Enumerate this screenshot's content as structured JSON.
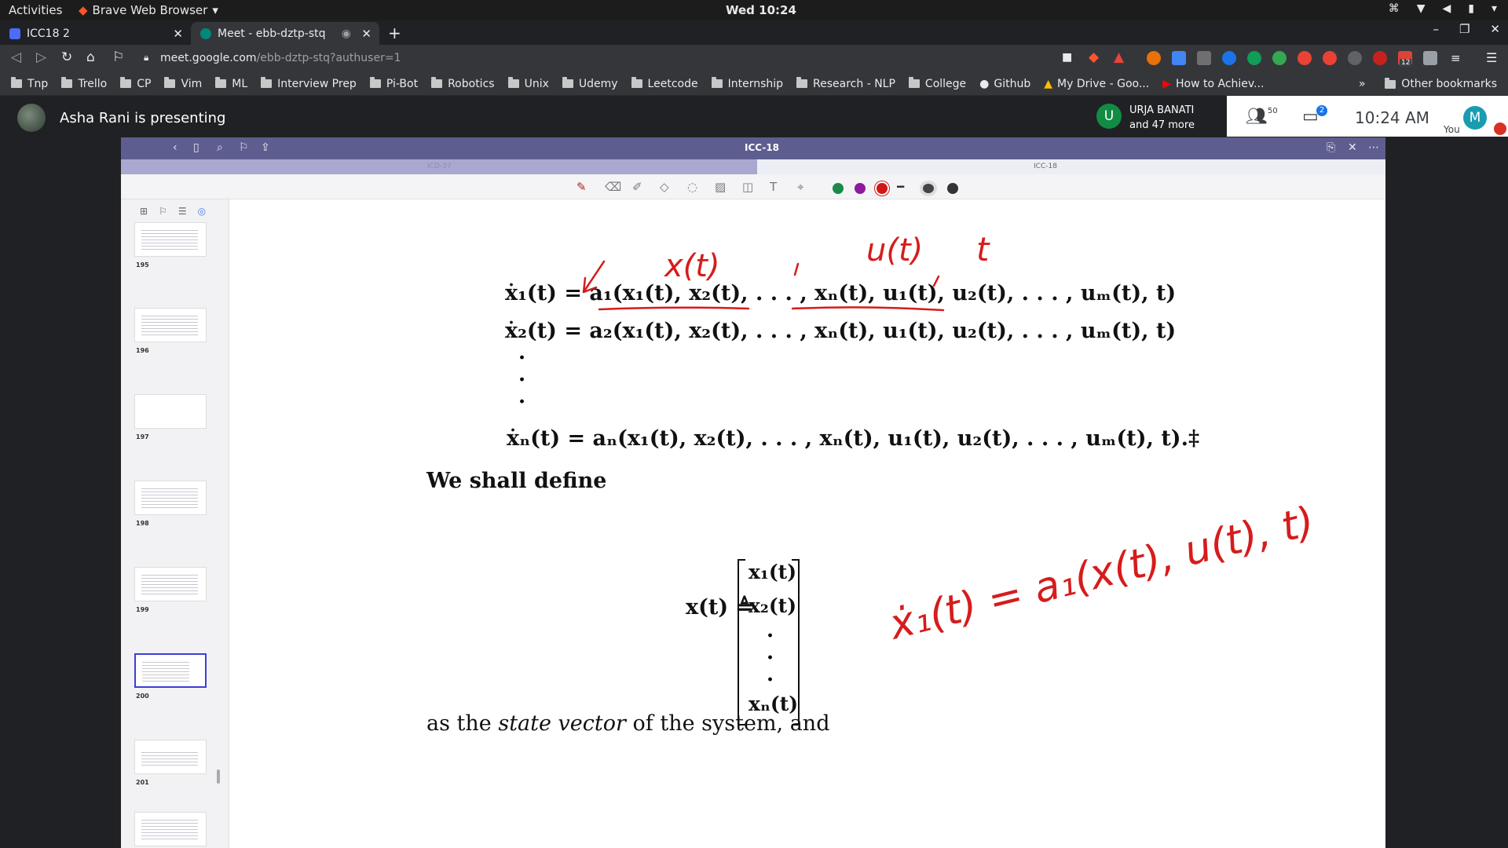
{
  "system": {
    "activities": "Activities",
    "app_name": "Brave Web Browser",
    "clock": "Wed 10:24"
  },
  "browser": {
    "tabs": [
      {
        "label": "ICC18 2",
        "fav_color": "#4a6cf7"
      },
      {
        "label": "Meet - ebb-dztp-stq",
        "fav_color": "#00897b"
      }
    ],
    "url_host": "meet.google.com",
    "url_path": "/ebb-dztp-stq?authuser=1",
    "bookmarks": [
      "Tnp",
      "Trello",
      "CP",
      "Vim",
      "ML",
      "Interview Prep",
      "Pi-Bot",
      "Robotics",
      "Unix",
      "Udemy",
      "Leetcode",
      "Internship",
      "Research - NLP",
      "College"
    ],
    "bookmarks_extra": [
      "Github",
      "My Drive - Goo...",
      "How to Achiev..."
    ],
    "other_bookmarks": "Other bookmarks",
    "ext_colors": [
      "#e8710a",
      "#4285f4",
      "#6f6f6f",
      "#1a73e8",
      "#0f9d58",
      "#34a853",
      "#ea4335",
      "#e94235",
      "#5f6368",
      "#c5221f",
      "#db4437",
      "#9aa0a6"
    ],
    "ext_badge": "12"
  },
  "meet": {
    "presenting": "Asha Rani is presenting",
    "participant_initial": "U",
    "participant_name": "URJA BANATI",
    "participant_more": "and 47 more",
    "people_count": "50",
    "chat_badge": "2",
    "time": "10:24 AM",
    "you_initial": "M",
    "you_label": "You"
  },
  "viewer": {
    "title": "ICC-18",
    "tab_left": "ICD-37",
    "tab_right": "ICC-18",
    "pen_colors": [
      "#1a8a4a",
      "#8e1a9e",
      "#d01818"
    ],
    "thumbnails": [
      {
        "page": "195"
      },
      {
        "page": "196"
      },
      {
        "page": "197"
      },
      {
        "page": "198"
      },
      {
        "page": "199"
      },
      {
        "page": "200",
        "selected": true
      },
      {
        "page": "201"
      }
    ]
  },
  "document": {
    "eq1_lhs": "ẋ₁(t) = a₁(x₁(t), x₂(t), . . . , xₙ(t), u₁(t), u₂(t), . . . , uₘ(t), t)",
    "eq2_lhs": "ẋ₂(t) = a₂(x₁(t), x₂(t), . . . , xₙ(t), u₁(t), u₂(t), . . . , uₘ(t), t)",
    "eq3_lhs": "ẋₙ(t) = aₙ(x₁(t), x₂(t), . . . , xₙ(t), u₁(t), u₂(t), . . . , uₘ(t), t).‡",
    "define": "We shall define",
    "state_lhs": "x(t) ≜",
    "vector": [
      "x₁(t)",
      "x₂(t)",
      "xₙ(t)"
    ],
    "state_sentence_a": "as the ",
    "state_sentence_em": "state vector",
    "state_sentence_b": " of the system, and",
    "ink_x": "x(t)",
    "ink_u": "u(t)",
    "ink_t": "t",
    "ink_eq": "ẋ₁(t) = a₁(x(t), u(t), t)"
  }
}
